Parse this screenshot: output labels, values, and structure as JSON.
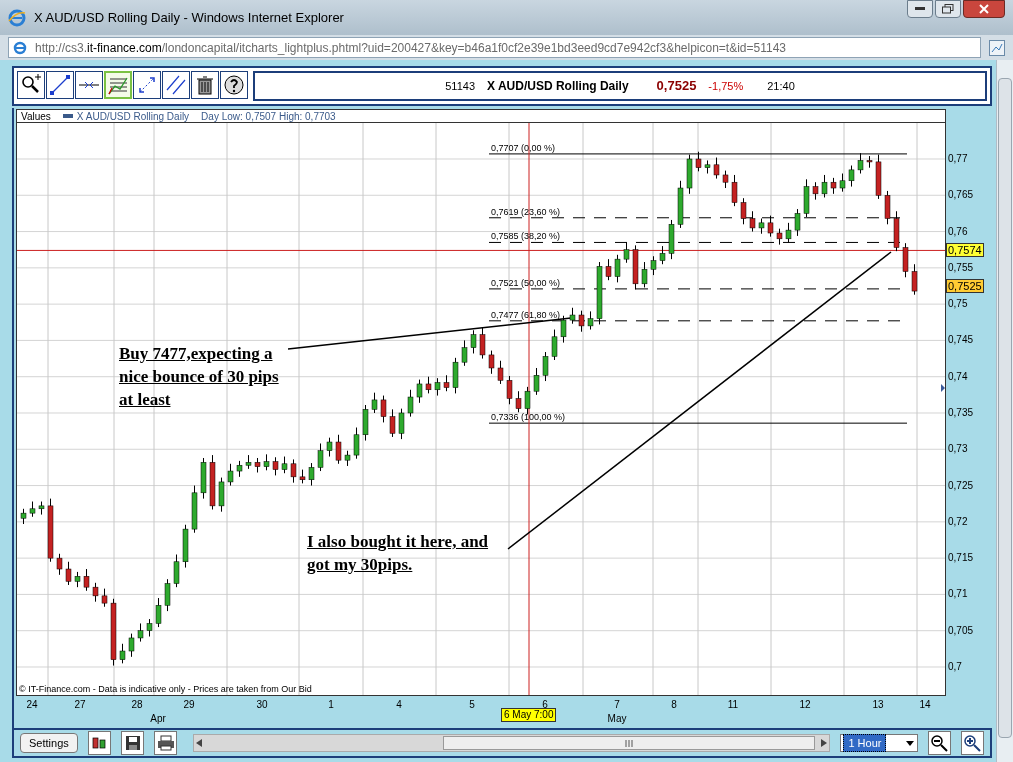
{
  "window": {
    "title": "X AUD/USD Rolling Daily - Windows Internet Explorer"
  },
  "address": {
    "prefix": "http://cs3.",
    "domain": "it-finance.com",
    "path": "/londoncapital/itcharts_lightplus.phtml?uid=200427&key=b46a1f0cf2e39e1bd3eed9cd7e942cf3&helpicon=t&id=51143"
  },
  "tools": [
    {
      "kind": "zoom",
      "selected": false
    },
    {
      "kind": "line",
      "selected": false
    },
    {
      "kind": "hline",
      "selected": false
    },
    {
      "kind": "fib",
      "selected": true
    },
    {
      "kind": "arrows",
      "selected": false
    },
    {
      "kind": "parallel",
      "selected": false
    },
    {
      "kind": "trash",
      "selected": false
    },
    {
      "kind": "help",
      "selected": false
    }
  ],
  "quote": {
    "id": "51143",
    "name": "X AUD/USD Rolling Daily",
    "price": "0,7525",
    "change": "-1,75%",
    "time": "21:40"
  },
  "legend": {
    "label": "Values",
    "series": "X AUD/USD Rolling Daily",
    "range": "Day Low: 0,7507 High: 0,7703"
  },
  "chart": {
    "chart_data": {
      "type": "candlestick",
      "grid": true,
      "ref_lines": [
        {
          "axis": "y",
          "value": 0.7574,
          "color": "#cc2020"
        }
      ],
      "ylim": [
        0.69614,
        0.77496
      ],
      "yticks": [
        {
          "value": 0.77,
          "label": "0,77"
        },
        {
          "value": 0.765,
          "label": "0,765"
        },
        {
          "value": 0.76,
          "label": "0,76"
        },
        {
          "value": 0.755,
          "label": "0,755"
        },
        {
          "value": 0.75,
          "label": "0,75"
        },
        {
          "value": 0.745,
          "label": "0,745"
        },
        {
          "value": 0.74,
          "label": "0,74"
        },
        {
          "value": 0.735,
          "label": "0,735"
        },
        {
          "value": 0.73,
          "label": "0,73"
        },
        {
          "value": 0.725,
          "label": "0,725"
        },
        {
          "value": 0.72,
          "label": "0,72"
        },
        {
          "value": 0.715,
          "label": "0,715"
        },
        {
          "value": 0.71,
          "label": "0,71"
        },
        {
          "value": 0.705,
          "label": "0,705"
        },
        {
          "value": 0.7,
          "label": "0,7"
        }
      ],
      "categories": [
        null,
        null,
        null,
        null,
        null,
        null,
        null,
        null,
        null,
        null,
        null,
        null,
        null,
        null,
        null,
        null,
        null,
        null,
        null,
        null,
        null,
        null,
        null,
        null,
        null,
        null,
        null,
        null,
        null,
        null,
        null,
        null,
        null,
        null,
        null,
        null,
        null,
        null,
        null,
        null,
        null,
        null,
        null,
        null,
        null,
        null,
        null,
        null,
        null,
        null,
        null,
        null,
        null,
        null,
        null,
        null,
        null,
        null,
        null,
        null,
        null,
        null,
        null,
        null,
        null,
        null,
        null,
        null,
        null,
        null,
        null,
        null,
        null,
        null,
        null,
        null,
        null,
        null,
        null,
        null,
        null,
        null,
        null,
        null,
        null,
        null,
        null,
        null,
        null,
        null,
        null,
        null,
        null,
        null,
        null,
        null,
        null,
        null,
        null,
        null
      ],
      "ohlc": [
        [
          0.7205,
          0.7218,
          0.7197,
          0.7212
        ],
        [
          0.7212,
          0.7228,
          0.7207,
          0.7218
        ],
        [
          0.7218,
          0.7228,
          0.721,
          0.7222
        ],
        [
          0.7222,
          0.7232,
          0.7145,
          0.715
        ],
        [
          0.715,
          0.7156,
          0.7127,
          0.7135
        ],
        [
          0.7135,
          0.7145,
          0.7113,
          0.7118
        ],
        [
          0.7118,
          0.7131,
          0.711,
          0.7125
        ],
        [
          0.7125,
          0.7135,
          0.7105,
          0.711
        ],
        [
          0.711,
          0.7116,
          0.709,
          0.7098
        ],
        [
          0.7098,
          0.7108,
          0.7083,
          0.7088
        ],
        [
          0.7088,
          0.7094,
          0.7002,
          0.701
        ],
        [
          0.701,
          0.7032,
          0.7005,
          0.7022
        ],
        [
          0.7022,
          0.7046,
          0.7014,
          0.704
        ],
        [
          0.704,
          0.706,
          0.7035,
          0.705
        ],
        [
          0.705,
          0.7066,
          0.7042,
          0.706
        ],
        [
          0.706,
          0.7095,
          0.7055,
          0.7085
        ],
        [
          0.7085,
          0.7121,
          0.7077,
          0.7115
        ],
        [
          0.7115,
          0.7155,
          0.711,
          0.7145
        ],
        [
          0.7145,
          0.7196,
          0.7137,
          0.719
        ],
        [
          0.719,
          0.725,
          0.7185,
          0.724
        ],
        [
          0.724,
          0.7288,
          0.7232,
          0.7282
        ],
        [
          0.7282,
          0.7292,
          0.7217,
          0.7222
        ],
        [
          0.7222,
          0.7261,
          0.7214,
          0.7255
        ],
        [
          0.7255,
          0.728,
          0.725,
          0.727
        ],
        [
          0.727,
          0.7284,
          0.7262,
          0.7278
        ],
        [
          0.7278,
          0.7292,
          0.7273,
          0.7282
        ],
        [
          0.7282,
          0.7288,
          0.7268,
          0.7276
        ],
        [
          0.7276,
          0.7293,
          0.7271,
          0.7283
        ],
        [
          0.7283,
          0.7289,
          0.7264,
          0.7272
        ],
        [
          0.7272,
          0.729,
          0.7267,
          0.728
        ],
        [
          0.728,
          0.7286,
          0.7254,
          0.7262
        ],
        [
          0.7262,
          0.7272,
          0.7253,
          0.7258
        ],
        [
          0.7258,
          0.7281,
          0.725,
          0.7275
        ],
        [
          0.7275,
          0.7308,
          0.727,
          0.7298
        ],
        [
          0.7298,
          0.7316,
          0.729,
          0.731
        ],
        [
          0.731,
          0.732,
          0.728,
          0.7285
        ],
        [
          0.7285,
          0.7298,
          0.7277,
          0.7292
        ],
        [
          0.7292,
          0.733,
          0.7287,
          0.732
        ],
        [
          0.732,
          0.7361,
          0.7312,
          0.7355
        ],
        [
          0.7355,
          0.7378,
          0.735,
          0.7368
        ],
        [
          0.7368,
          0.7374,
          0.7337,
          0.7345
        ],
        [
          0.7345,
          0.7355,
          0.7317,
          0.7322
        ],
        [
          0.7322,
          0.7356,
          0.7314,
          0.735
        ],
        [
          0.735,
          0.7382,
          0.7345,
          0.7372
        ],
        [
          0.7372,
          0.7396,
          0.7364,
          0.739
        ],
        [
          0.739,
          0.74,
          0.7377,
          0.7382
        ],
        [
          0.7382,
          0.7398,
          0.7374,
          0.7392
        ],
        [
          0.7392,
          0.7402,
          0.738,
          0.7385
        ],
        [
          0.7385,
          0.7426,
          0.7377,
          0.742
        ],
        [
          0.742,
          0.745,
          0.7415,
          0.744
        ],
        [
          0.744,
          0.7464,
          0.7432,
          0.7458
        ],
        [
          0.7458,
          0.7468,
          0.7425,
          0.743
        ],
        [
          0.743,
          0.7436,
          0.7404,
          0.7412
        ],
        [
          0.7412,
          0.7422,
          0.739,
          0.7395
        ],
        [
          0.7395,
          0.7401,
          0.7362,
          0.737
        ],
        [
          0.737,
          0.738,
          0.7351,
          0.7356
        ],
        [
          0.7356,
          0.7386,
          0.7348,
          0.738
        ],
        [
          0.738,
          0.7412,
          0.7375,
          0.7402
        ],
        [
          0.7402,
          0.7434,
          0.7394,
          0.7428
        ],
        [
          0.7428,
          0.7465,
          0.7423,
          0.7455
        ],
        [
          0.7455,
          0.7484,
          0.7447,
          0.7478
        ],
        [
          0.7478,
          0.7495,
          0.7473,
          0.7485
        ],
        [
          0.7485,
          0.7491,
          0.7462,
          0.747
        ],
        [
          0.747,
          0.749,
          0.7465,
          0.748
        ],
        [
          0.748,
          0.7558,
          0.7472,
          0.7552
        ],
        [
          0.7552,
          0.7562,
          0.7533,
          0.7538
        ],
        [
          0.7538,
          0.7568,
          0.753,
          0.7562
        ],
        [
          0.7562,
          0.7585,
          0.7557,
          0.7575
        ],
        [
          0.7575,
          0.7581,
          0.752,
          0.7528
        ],
        [
          0.7528,
          0.7558,
          0.7523,
          0.7548
        ],
        [
          0.7548,
          0.7566,
          0.754,
          0.756
        ],
        [
          0.756,
          0.758,
          0.7555,
          0.757
        ],
        [
          0.757,
          0.7616,
          0.7562,
          0.761
        ],
        [
          0.761,
          0.767,
          0.7605,
          0.766
        ],
        [
          0.766,
          0.7706,
          0.7652,
          0.77
        ],
        [
          0.77,
          0.771,
          0.7683,
          0.7688
        ],
        [
          0.7688,
          0.7698,
          0.768,
          0.7692
        ],
        [
          0.7692,
          0.7702,
          0.7673,
          0.7678
        ],
        [
          0.7678,
          0.7684,
          0.766,
          0.7668
        ],
        [
          0.7668,
          0.7678,
          0.7635,
          0.764
        ],
        [
          0.764,
          0.7646,
          0.761,
          0.7618
        ],
        [
          0.7618,
          0.7628,
          0.76,
          0.7605
        ],
        [
          0.7605,
          0.7618,
          0.7597,
          0.7612
        ],
        [
          0.7612,
          0.7622,
          0.7593,
          0.7598
        ],
        [
          0.7598,
          0.7604,
          0.7582,
          0.759
        ],
        [
          0.759,
          0.7612,
          0.7585,
          0.7602
        ],
        [
          0.7602,
          0.7631,
          0.7594,
          0.7625
        ],
        [
          0.7625,
          0.7672,
          0.762,
          0.7662
        ],
        [
          0.7662,
          0.7668,
          0.7644,
          0.7652
        ],
        [
          0.7652,
          0.7678,
          0.7647,
          0.7668
        ],
        [
          0.7668,
          0.7674,
          0.7652,
          0.766
        ],
        [
          0.766,
          0.768,
          0.7655,
          0.767
        ],
        [
          0.767,
          0.7691,
          0.7662,
          0.7685
        ],
        [
          0.7685,
          0.7708,
          0.768,
          0.7698
        ],
        [
          0.7698,
          0.7704,
          0.7688,
          0.7696
        ],
        [
          0.7696,
          0.7706,
          0.7645,
          0.765
        ],
        [
          0.765,
          0.7656,
          0.761,
          0.7618
        ],
        [
          0.7618,
          0.7628,
          0.7573,
          0.7578
        ],
        [
          0.7578,
          0.7584,
          0.7537,
          0.7545
        ],
        [
          0.7545,
          0.7555,
          0.7513,
          0.7518
        ]
      ]
    }
  },
  "price_markers": [
    {
      "text": "0,7574",
      "color": "#ffff33"
    },
    {
      "text": "0,7525",
      "color": "#ffcc33"
    }
  ],
  "fib_levels": [
    {
      "label": "0,7707 (0,00 %)",
      "kind": "solid"
    },
    {
      "label": "0,7619 (23,60 %)",
      "kind": "dashed"
    },
    {
      "label": "0,7585 (38,20 %)",
      "kind": "dashed"
    },
    {
      "label": "0,7521 (50,00 %)",
      "kind": "dashed"
    },
    {
      "label": "0,7477 (61,80 %)",
      "kind": "dashed"
    },
    {
      "label": "0,7336 (100,00 %)",
      "kind": "solid"
    }
  ],
  "annotations": [
    "Buy 7477,expecting a nice bounce of 30 pips at least",
    "I also bought it here, and got my 30pips."
  ],
  "footer": "© IT-Finance.com - Data is indicative only - Prices are taken from Our Bid",
  "date_axis": [
    "24",
    "27",
    "28",
    "29",
    "30",
    "1",
    "4",
    "5",
    "6",
    "7",
    "8",
    "11",
    "12",
    "13",
    "14"
  ],
  "months": [
    "Apr",
    "May"
  ],
  "cursor_time": "6 May 7:00",
  "bottom": {
    "settings": "Settings",
    "interval": "1 Hour"
  }
}
